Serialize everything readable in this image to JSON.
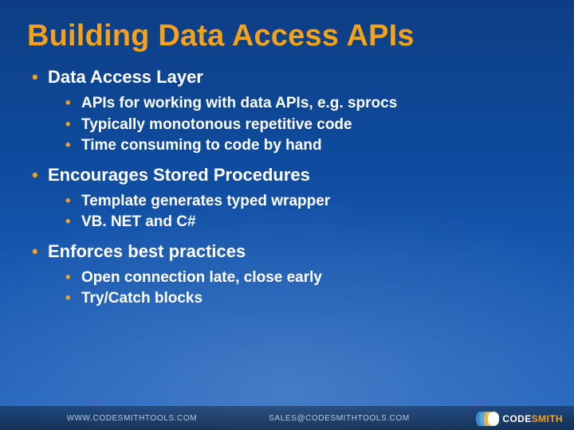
{
  "title": "Building Data Access APIs",
  "bullets": [
    {
      "label": "Data Access Layer",
      "children": [
        "APIs for working with data APIs, e.g. sprocs",
        "Typically monotonous repetitive code",
        "Time consuming to code by hand"
      ]
    },
    {
      "label": "Encourages Stored Procedures",
      "children": [
        "Template generates typed wrapper",
        "VB. NET and C#"
      ]
    },
    {
      "label": "Enforces best practices",
      "children": [
        "Open connection late, close early",
        "Try/Catch blocks"
      ]
    }
  ],
  "footer": {
    "url": "WWW.CODESMITHTOOLS.COM",
    "email": "SALES@CODESMITHTOOLS.COM",
    "logo_a": "CODE",
    "logo_b": "SMITH"
  }
}
